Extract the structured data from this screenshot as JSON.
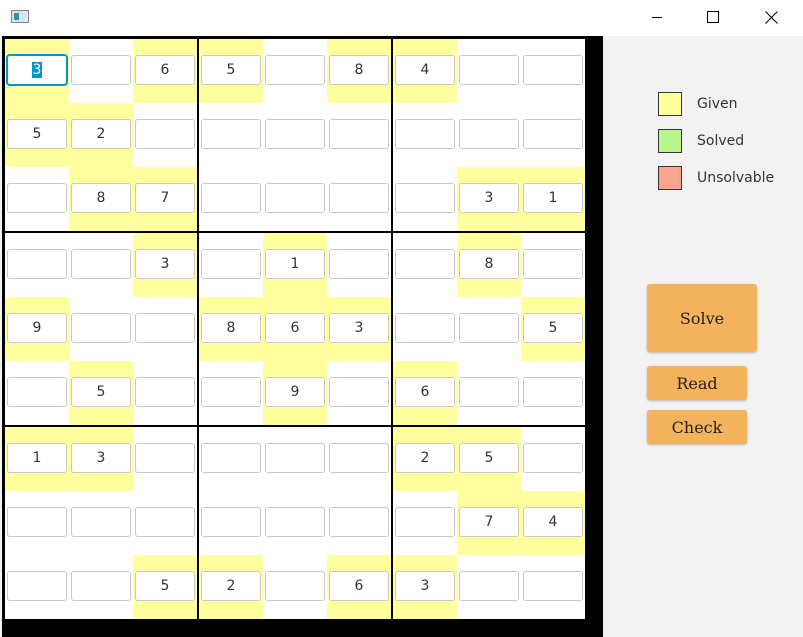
{
  "window": {
    "controls": {
      "minimize_icon": "minimize-icon",
      "maximize_icon": "maximize-icon",
      "close_icon": "close-icon"
    }
  },
  "sudoku": {
    "focused_cell": [
      0,
      0
    ],
    "grid": [
      [
        "3",
        "",
        "6",
        "5",
        "",
        "8",
        "4",
        "",
        ""
      ],
      [
        "5",
        "2",
        "",
        "",
        "",
        "",
        "",
        "",
        ""
      ],
      [
        "",
        "8",
        "7",
        "",
        "",
        "",
        "",
        "3",
        "1"
      ],
      [
        "",
        "",
        "3",
        "",
        "1",
        "",
        "",
        "8",
        ""
      ],
      [
        "9",
        "",
        "",
        "8",
        "6",
        "3",
        "",
        "",
        "5"
      ],
      [
        "",
        "5",
        "",
        "",
        "9",
        "",
        "6",
        "",
        ""
      ],
      [
        "1",
        "3",
        "",
        "",
        "",
        "",
        "2",
        "5",
        ""
      ],
      [
        "",
        "",
        "",
        "",
        "",
        "",
        "",
        "7",
        "4"
      ],
      [
        "",
        "",
        "5",
        "2",
        "",
        "6",
        "3",
        "",
        ""
      ]
    ],
    "given": [
      [
        1,
        0,
        1,
        1,
        0,
        1,
        1,
        0,
        0
      ],
      [
        1,
        1,
        0,
        0,
        0,
        0,
        0,
        0,
        0
      ],
      [
        0,
        1,
        1,
        0,
        0,
        0,
        0,
        1,
        1
      ],
      [
        0,
        0,
        1,
        0,
        1,
        0,
        0,
        1,
        0
      ],
      [
        1,
        0,
        0,
        1,
        1,
        1,
        0,
        0,
        1
      ],
      [
        0,
        1,
        0,
        0,
        1,
        0,
        1,
        0,
        0
      ],
      [
        1,
        1,
        0,
        0,
        0,
        0,
        1,
        1,
        0
      ],
      [
        0,
        0,
        0,
        0,
        0,
        0,
        0,
        1,
        1
      ],
      [
        0,
        0,
        1,
        1,
        0,
        1,
        1,
        0,
        0
      ]
    ]
  },
  "legend": {
    "items": [
      {
        "label": "Given",
        "color": "#ffff9e"
      },
      {
        "label": "Solved",
        "color": "#b8f58a"
      },
      {
        "label": "Unsolvable",
        "color": "#fca58e"
      }
    ]
  },
  "actions": {
    "solve_label": "Solve",
    "read_label": "Read",
    "check_label": "Check",
    "color": "#f4b25c"
  }
}
